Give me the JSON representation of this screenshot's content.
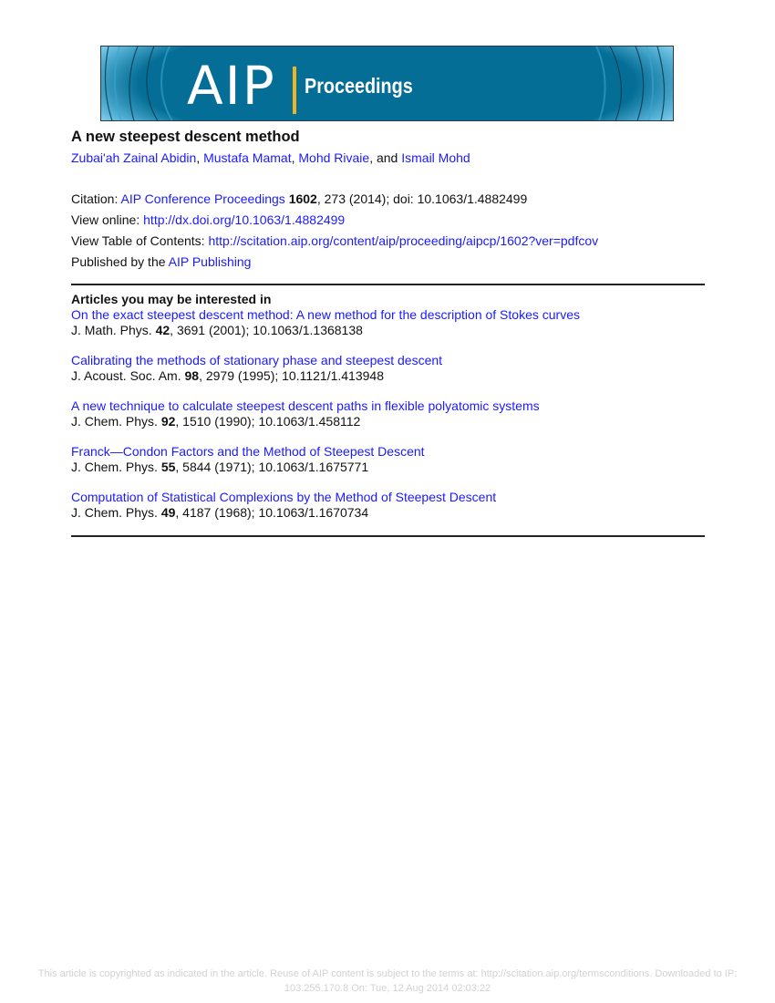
{
  "banner": {
    "logo_text": "AIP",
    "product_text": "Proceedings",
    "colors": {
      "background": "#046e96",
      "accent_bar": "#f2b51f",
      "text": "#ffffff"
    }
  },
  "article": {
    "title": "A new steepest descent method",
    "authors": [
      {
        "name": "Zubai'ah Zainal Abidin",
        "sep": ", "
      },
      {
        "name": "Mustafa Mamat",
        "sep": ", "
      },
      {
        "name": "Mohd Rivaie",
        "sep": ", and "
      },
      {
        "name": "Ismail Mohd",
        "sep": ""
      }
    ]
  },
  "meta": {
    "citation_label": "Citation: ",
    "citation_journal": "AIP Conference Proceedings",
    "citation_volume": "1602",
    "citation_rest": ", 273 (2014); doi: 10.1063/1.4882499",
    "view_online_label": "View online: ",
    "view_online_url": "http://dx.doi.org/10.1063/1.4882499",
    "toc_label": "View Table of Contents: ",
    "toc_url": "http://scitation.aip.org/content/aip/proceeding/aipcp/1602?ver=pdfcov",
    "published_label": "Published by the ",
    "publisher": "AIP Publishing"
  },
  "related": {
    "heading": "Articles you may be interested in",
    "items": [
      {
        "title": "On the exact steepest descent method: A new method for the description of Stokes curves",
        "journal": "J. Math. Phys. ",
        "volume": "42",
        "rest": ", 3691 (2001); 10.1063/1.1368138"
      },
      {
        "title": "Calibrating the methods of stationary phase and steepest descent",
        "journal": "J. Acoust. Soc. Am. ",
        "volume": "98",
        "rest": ", 2979 (1995); 10.1121/1.413948"
      },
      {
        "title": "A new technique to calculate steepest descent paths in flexible polyatomic systems",
        "journal": "J. Chem. Phys. ",
        "volume": "92",
        "rest": ", 1510 (1990); 10.1063/1.458112"
      },
      {
        "title": "Franck—Condon Factors and the Method of Steepest Descent",
        "journal": "J. Chem. Phys. ",
        "volume": "55",
        "rest": ", 5844 (1971); 10.1063/1.1675771"
      },
      {
        "title": "Computation of Statistical Complexions by the Method of Steepest Descent",
        "journal": "J. Chem. Phys. ",
        "volume": "49",
        "rest": ", 4187 (1968); 10.1063/1.1670734"
      }
    ]
  },
  "footer": {
    "line1": "This article is copyrighted as indicated in the article. Reuse of AIP content is subject to the terms at: http://scitation.aip.org/termsconditions. Downloaded to  IP:",
    "line2": "103.255.170.8 On: Tue, 12 Aug 2014 02:03:22"
  }
}
